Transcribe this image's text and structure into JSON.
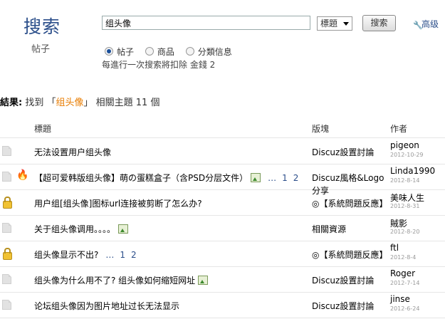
{
  "header": {
    "brand": "搜索",
    "subtitle": "帖子"
  },
  "search": {
    "value": "组头像",
    "type_selected": "標題",
    "submit_label": "搜索",
    "advanced_label": "高级"
  },
  "scope": {
    "options": [
      "帖子",
      "商品",
      "分類信息"
    ],
    "selected": "帖子"
  },
  "note": "每進行一次搜索將扣除 金錢 2",
  "result": {
    "prefix": "結果:",
    "found": "找到 「",
    "keyword": "组头像",
    "suffix": "」 相關主題 11 個"
  },
  "table": {
    "headers": {
      "title": "標題",
      "forum": "版塊",
      "author": "作者"
    },
    "rows": [
      {
        "icon": "doc-icon",
        "title": "无法设置用户组头像",
        "attachment": false,
        "pages": [],
        "forum": "Discuz設置討論",
        "forum2": "",
        "author": "pigeon",
        "date": "2012-10-29"
      },
      {
        "icon": "doc-icon",
        "hot": true,
        "title": "【超可爱韩版组头像】萌の蛋糕盒子（含PSD分层文件）",
        "attachment": true,
        "pages": [
          "…",
          "1",
          "2"
        ],
        "forum": "Discuz風格&Logo",
        "forum2": "分享",
        "author": "Linda1990",
        "date": "2012-8-14"
      },
      {
        "icon": "lock-icon",
        "title": "用户组[组头像]图标url连接被剪断了怎么办?",
        "attachment": false,
        "pages": [],
        "forum": "◎【系統問題反應】",
        "forum2": "",
        "author": "美味人生",
        "date": "2012-8-31"
      },
      {
        "icon": "doc-icon",
        "title": "关于组头像调用。。。。",
        "attachment": true,
        "pages": [],
        "forum": "相關資源",
        "forum2": "",
        "author": "賊影",
        "date": "2012-8-20"
      },
      {
        "icon": "lock-icon",
        "title": "组头像显示不出?",
        "attachment": false,
        "pages": [
          "…",
          "1",
          "2"
        ],
        "forum": "◎【系統問題反應】",
        "forum2": "",
        "author": "ftl",
        "date": "2012-8-4"
      },
      {
        "icon": "doc-icon",
        "title": "组头像为什么用不了? 组头像如何缩短网址",
        "attachment": true,
        "pages": [],
        "forum": "Discuz設置討論",
        "forum2": "",
        "author": "Roger",
        "date": "2012-7-14"
      },
      {
        "icon": "doc-icon",
        "title": "论坛组头像因为图片地址过长无法显示",
        "attachment": false,
        "pages": [],
        "forum": "Discuz設置討論",
        "forum2": "",
        "author": "jinse",
        "date": "2012-6-24"
      }
    ]
  }
}
